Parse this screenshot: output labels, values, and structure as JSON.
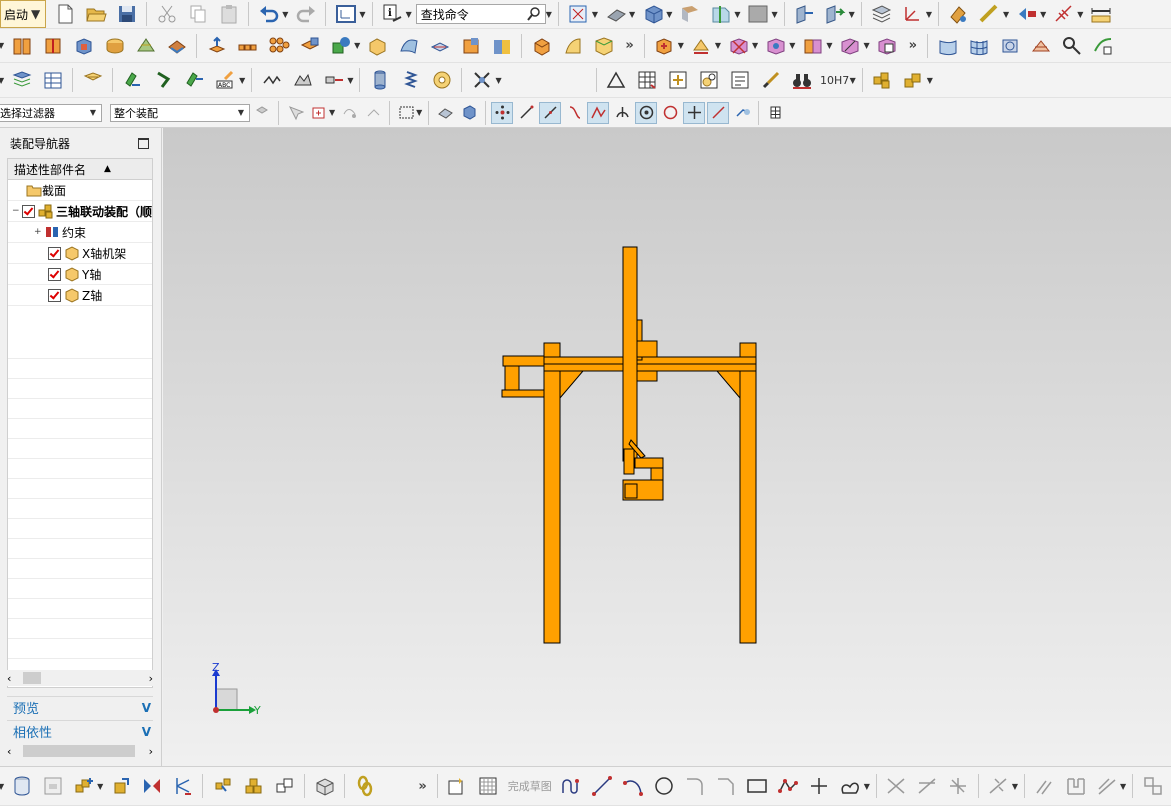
{
  "toolbar": {
    "start_label": "启动",
    "search_placeholder": "查找命令",
    "row1_icons": [
      "new-file-icon",
      "open-folder-icon",
      "save-icon",
      "cut-icon",
      "copy-icon",
      "paste-icon",
      "undo-icon",
      "redo-icon",
      "view-window-icon",
      "info-icon"
    ],
    "row1_right_icons": [
      "fit-view-icon",
      "render-style-icon",
      "shaded-cube-icon",
      "face-analysis-icon",
      "section-view-icon",
      "background-color-icon",
      "move-component-icon",
      "reposition-icon",
      "layer-settings-icon",
      "wcs-icon",
      "display-icon",
      "measure-icon",
      "snap-icon",
      "dimension-icon",
      "ruler-icon"
    ],
    "row2_icons": [
      "book-icon",
      "layers-icon",
      "block-icon",
      "cylinder-icon",
      "cone-icon",
      "sphere-icon",
      "extrude-icon",
      "array-icon",
      "pattern-icon",
      "union-icon",
      "subtract-icon",
      "intersect-icon",
      "surface-icon",
      "sweep-icon",
      "fillet-icon",
      "chamfer-icon",
      "shell-icon",
      "draft-icon",
      "blend-icon",
      "assembly-add-icon",
      "constraint-icon",
      "mirror-icon",
      "exploded-view-icon",
      "component-icon",
      "clearance-icon",
      "surface-grid-icon",
      "shaded-surface-icon",
      "mesh-icon",
      "rotate-surface-icon",
      "offset-icon",
      "tools-icon"
    ],
    "row3_icons": [
      "layer-stack-icon",
      "table-icon",
      "note-icon",
      "green-part-icon",
      "wave-icon",
      "move-icon",
      "text-abc-icon",
      "thread-icon",
      "groove-icon",
      "slot-icon",
      "spring-icon",
      "coil-icon",
      "bearing-icon",
      "scissor-icon"
    ],
    "row3_right_icons": [
      "triangle-icon",
      "grid-table-icon",
      "symbol-icon",
      "parts-list-icon",
      "note-frame-icon",
      "brush-icon",
      "binoculars-icon",
      "fit-tolerance-icon",
      "assembly-tree-icon",
      "boxes-icon"
    ],
    "fit_label": "10H7",
    "filter_label": "选择过滤器",
    "scope_label": "整个装配",
    "row4_icons": [
      "snap-point-icon",
      "endpoint-icon",
      "midpoint-icon",
      "tangent-icon",
      "arc-center-icon",
      "quadrant-icon",
      "bisector-icon",
      "center-icon",
      "circle-icon",
      "intersection-icon",
      "on-curve-icon",
      "pole-icon",
      "table-grid-icon"
    ]
  },
  "navigator": {
    "title": "装配导航器",
    "column_header": "描述性部件名",
    "tree": [
      {
        "label": "截面",
        "icon": "folder-icon",
        "indent": 0,
        "checkbox": false
      },
      {
        "label": "三轴联动装配（顺",
        "icon": "assembly-icon",
        "indent": 0,
        "checkbox": true,
        "bold": true
      },
      {
        "label": "约束",
        "icon": "constraint-icon",
        "indent": 1,
        "checkbox": false
      },
      {
        "label": "X轴机架",
        "icon": "part-icon",
        "indent": 1,
        "checkbox": true
      },
      {
        "label": "Y轴",
        "icon": "part-icon",
        "indent": 1,
        "checkbox": true
      },
      {
        "label": "Z轴",
        "icon": "part-icon",
        "indent": 1,
        "checkbox": true
      }
    ],
    "preview_label": "预览",
    "dependency_label": "相依性"
  },
  "viewport": {
    "model_color": "#ffa000",
    "axis_z_label": "Z",
    "axis_y_label": "Y"
  },
  "sketch_toolbar": {
    "finish_sketch_label": "完成草图",
    "icons": [
      "profile-icon",
      "line-icon",
      "arc-icon",
      "circle-icon",
      "fillet-icon",
      "chamfer-icon",
      "rectangle-icon",
      "polygon-icon",
      "point-icon",
      "spline-icon",
      "trim-icon",
      "extend-icon",
      "corner-icon",
      "mirror-curve-icon",
      "offset-curve-icon",
      "pattern-curve-icon",
      "dimension-icon",
      "constraint-icon"
    ]
  },
  "bottom_left_icons": [
    "layer-icon",
    "assembly-tree-icon",
    "add-component-icon",
    "move-component-icon",
    "mirror-assembly-icon",
    "explode-icon",
    "reposition-icon",
    "constraint-icon",
    "wave-linker-icon",
    "check-clearance-icon",
    "link-icon",
    "sketch-icon",
    "sketch-grid-icon"
  ]
}
